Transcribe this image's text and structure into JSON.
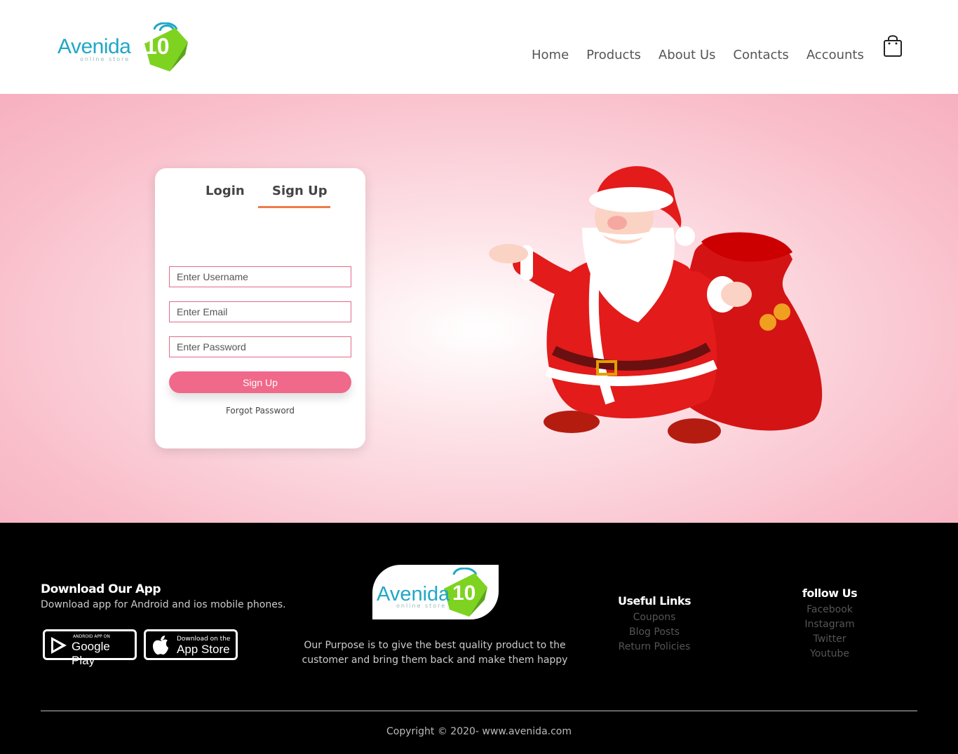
{
  "header": {
    "logo_text": "Avenida",
    "logo_number": "10",
    "logo_sub": "online store",
    "nav": [
      {
        "label": "Home"
      },
      {
        "label": "Products"
      },
      {
        "label": "About Us"
      },
      {
        "label": "Contacts"
      },
      {
        "label": "Accounts"
      }
    ]
  },
  "auth": {
    "tabs": {
      "login": "Login",
      "signup": "Sign Up"
    },
    "active_tab": "Sign Up",
    "username_placeholder": "Enter Username",
    "email_placeholder": "Enter Email",
    "password_placeholder": "Enter Password",
    "submit_label": "Sign Up",
    "forgot_label": "Forgot Password"
  },
  "footer": {
    "download_title": "Download Our App",
    "download_sub": "Download app for Android and ios mobile phones.",
    "google_play_small": "ANDROID APP ON",
    "google_play_big": "Google Play",
    "app_store_small": "Download on the",
    "app_store_big": "App Store",
    "purpose": "Our Purpose is to give the best quality product to the customer and bring them back and make them happy",
    "useful_links_title": "Useful Links",
    "useful_links": [
      "Coupons",
      "Blog Posts",
      "Return Policies"
    ],
    "follow_title": "follow Us",
    "follow_links": [
      "Facebook",
      "Instagram",
      "Twitter",
      "Youtube"
    ],
    "copyright": "Copyright © 2020- www.avenida.com"
  },
  "colors": {
    "accent": "#f0688a",
    "tab_underline": "#f07b48",
    "logo_blue": "#1fa7c7",
    "logo_green": "#7ed321"
  },
  "icons": [
    "shopping-bag-icon",
    "google-play-icon",
    "apple-icon"
  ]
}
